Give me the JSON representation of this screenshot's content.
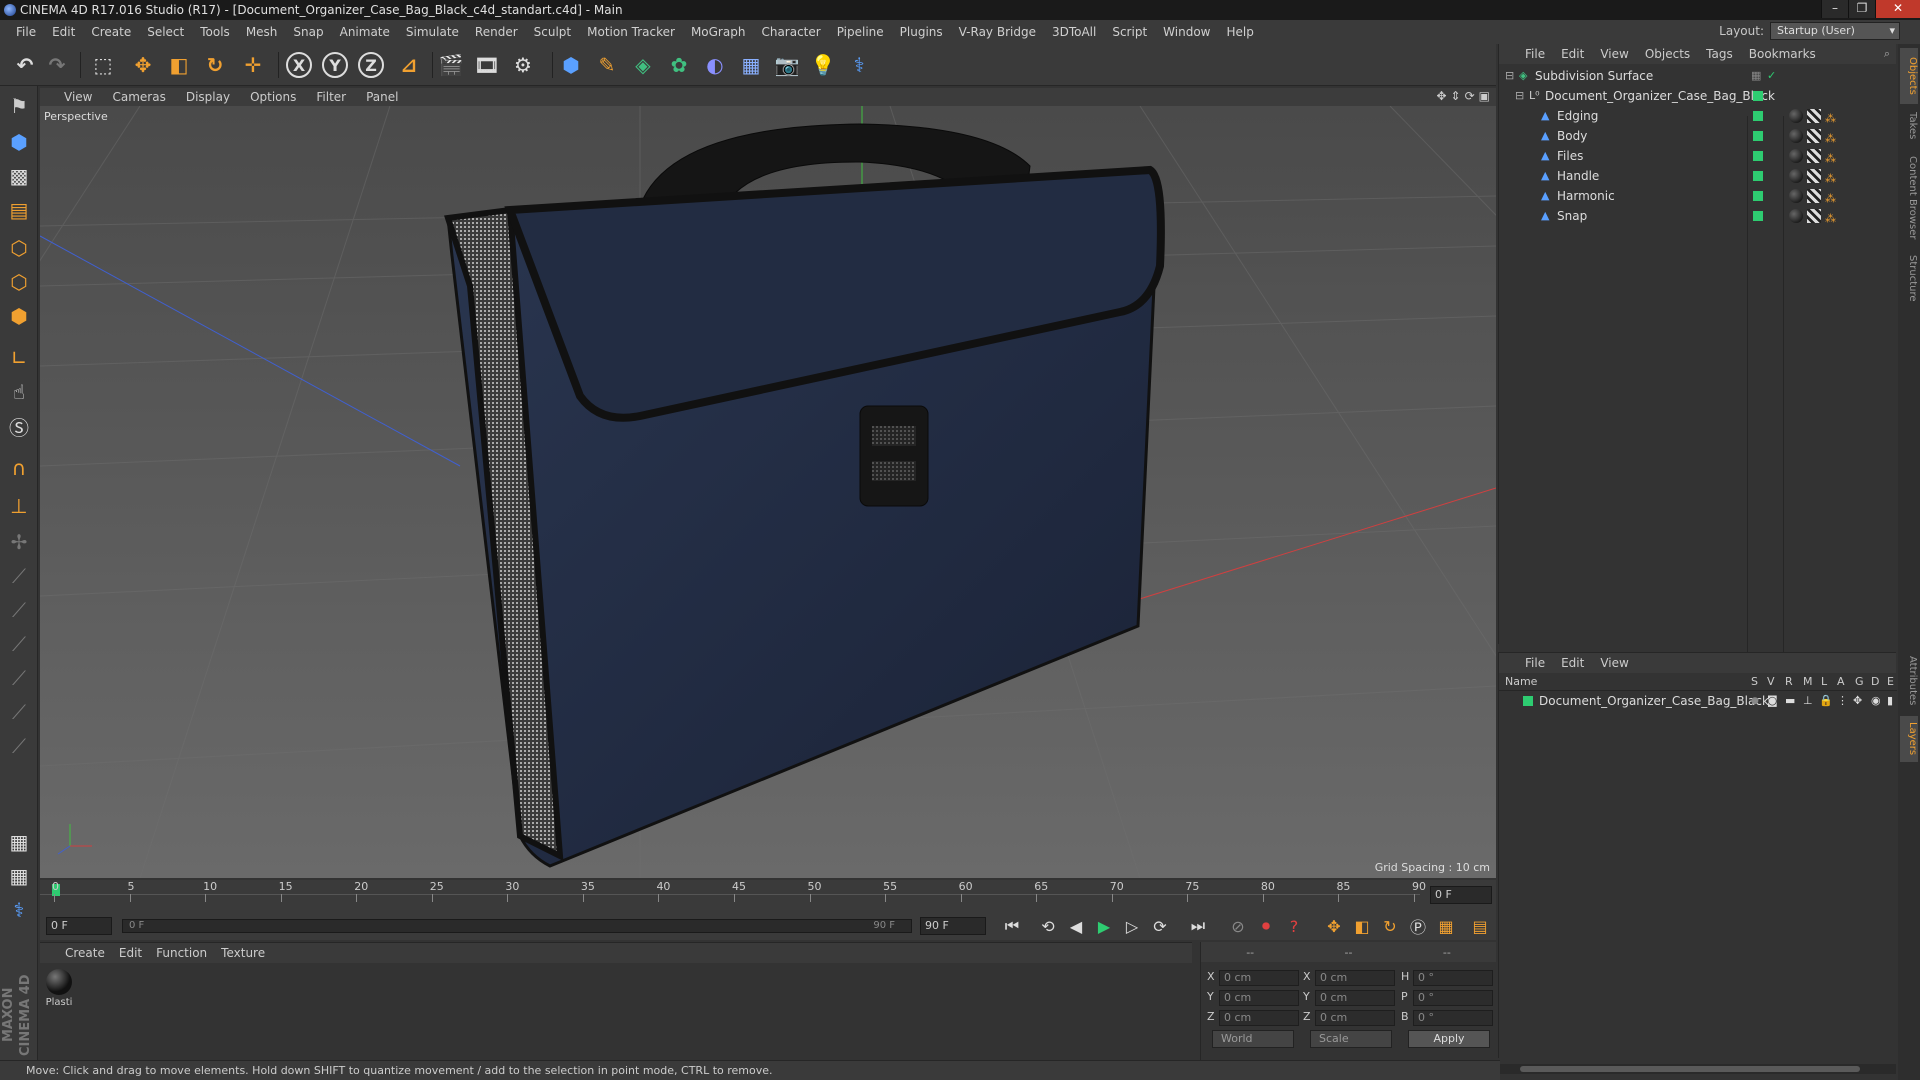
{
  "window": {
    "title": "CINEMA 4D R17.016 Studio (R17) - [Document_Organizer_Case_Bag_Black_c4d_standart.c4d] - Main",
    "controls": [
      "–",
      "❐",
      "✕"
    ]
  },
  "menubar": {
    "items": [
      "File",
      "Edit",
      "Create",
      "Select",
      "Tools",
      "Mesh",
      "Snap",
      "Animate",
      "Simulate",
      "Render",
      "Sculpt",
      "Motion Tracker",
      "MoGraph",
      "Character",
      "Pipeline",
      "Plugins",
      "V-Ray Bridge",
      "3DToAll",
      "Script",
      "Window",
      "Help"
    ],
    "layout_label": "Layout:",
    "layout_value": "Startup (User)"
  },
  "toolbar": {
    "x_label": "X",
    "y_label": "Y",
    "z_label": "Z"
  },
  "viewport": {
    "menu": [
      "View",
      "Cameras",
      "Display",
      "Options",
      "Filter",
      "Panel"
    ],
    "label": "Perspective",
    "grid_spacing": "Grid Spacing : 10 cm"
  },
  "timeline": {
    "ticks": [
      "0",
      "5",
      "10",
      "15",
      "20",
      "25",
      "30",
      "35",
      "40",
      "45",
      "50",
      "55",
      "60",
      "65",
      "70",
      "75",
      "80",
      "85",
      "90"
    ],
    "current_frame": "0 F",
    "start_frame": "0 F",
    "slider_start": "0 F",
    "slider_end": "90 F",
    "end_frame": "90 F"
  },
  "materials": {
    "menu": [
      "Create",
      "Edit",
      "Function",
      "Texture"
    ],
    "items": [
      {
        "name": "Plasti"
      }
    ]
  },
  "coordinates": {
    "headers": [
      "--",
      "--",
      "--"
    ],
    "rows": [
      {
        "a": "X",
        "av": "0 cm",
        "b": "X",
        "bv": "0 cm",
        "c": "H",
        "cv": "0 °"
      },
      {
        "a": "Y",
        "av": "0 cm",
        "b": "Y",
        "bv": "0 cm",
        "c": "P",
        "cv": "0 °"
      },
      {
        "a": "Z",
        "av": "0 cm",
        "b": "Z",
        "bv": "0 cm",
        "c": "B",
        "cv": "0 °"
      }
    ],
    "space": "World",
    "mode": "Scale",
    "apply": "Apply"
  },
  "object_manager": {
    "menu": [
      "File",
      "Edit",
      "View",
      "Objects",
      "Tags",
      "Bookmarks"
    ],
    "objects": [
      {
        "name": "Subdivision Surface"
      },
      {
        "name": "Document_Organizer_Case_Bag_Black"
      },
      {
        "name": "Edging"
      },
      {
        "name": "Body"
      },
      {
        "name": "Files"
      },
      {
        "name": "Handle"
      },
      {
        "name": "Harmonic"
      },
      {
        "name": "Snap"
      }
    ]
  },
  "layer_manager": {
    "menu": [
      "File",
      "Edit",
      "View"
    ],
    "name_header": "Name",
    "columns": [
      "S",
      "V",
      "R",
      "M",
      "L",
      "A",
      "G",
      "D",
      "E"
    ],
    "layer_name": "Document_Organizer_Case_Bag_Black"
  },
  "side_tabs": [
    "Objects",
    "Takes",
    "Content Browser",
    "Structure",
    "Attributes",
    "Layers"
  ],
  "status": "Move: Click and drag to move elements. Hold down SHIFT to quantize movement / add to the selection in point mode, CTRL to remove.",
  "brand": "MAXON CINEMA 4D",
  "colors": {
    "accent": "#f0a030",
    "layer_green": "#2ecc71",
    "axis_x": "#d04040",
    "axis_y": "#40c040",
    "axis_z": "#4060d0"
  }
}
